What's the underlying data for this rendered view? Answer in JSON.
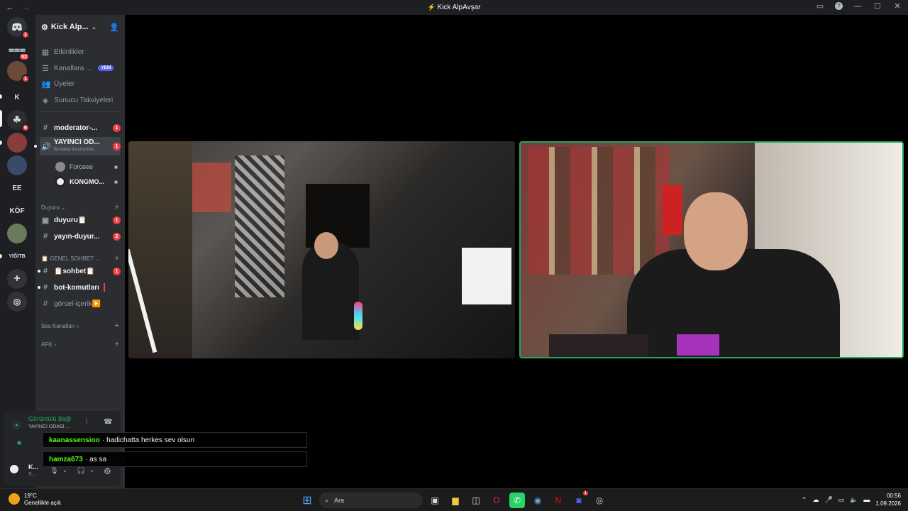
{
  "window": {
    "title": "Kick AlpAvşar",
    "back": "←",
    "forward": "→"
  },
  "guilds": [
    {
      "name": "discord-home",
      "label": "",
      "badge": "1"
    },
    {
      "name": "server-2",
      "label": "",
      "badge": "52"
    },
    {
      "name": "server-3",
      "label": "",
      "badge": "1"
    },
    {
      "name": "server-k",
      "label": "K",
      "badge": ""
    },
    {
      "name": "server-kick",
      "label": "",
      "badge": "6"
    },
    {
      "name": "server-6",
      "label": "",
      "badge": ""
    },
    {
      "name": "server-7",
      "label": "",
      "badge": ""
    },
    {
      "name": "server-ee",
      "label": "EE",
      "badge": ""
    },
    {
      "name": "server-kof",
      "label": "KÖF",
      "badge": ""
    },
    {
      "name": "server-10",
      "label": "",
      "badge": ""
    },
    {
      "name": "server-yigitb",
      "label": "YİĞİTB",
      "badge": ""
    }
  ],
  "server": {
    "name": "Kick Alp...",
    "links": [
      {
        "label": "Etkinlikler"
      },
      {
        "label": "Kanallara ...",
        "tag": "YENİ"
      },
      {
        "label": "Üyeler"
      },
      {
        "label": "Sunucu Takviyeleri"
      }
    ],
    "channels_top": [
      {
        "label": "moderator-...",
        "badge": "1"
      },
      {
        "label": "YAYINCI OD...",
        "sub": "Bir kanal durumu bel...",
        "badge": "1"
      }
    ],
    "voice_users": [
      {
        "name": "Forceee"
      },
      {
        "name": "KONGMO..."
      }
    ],
    "categories": {
      "duyuru": "Duyuru",
      "genel": "📋 GENEL SOHBET ...",
      "ses": "Ses Kanalları",
      "afk": "AFK"
    },
    "duyuru_channels": [
      {
        "label": "duyuru📋",
        "badge": "1"
      },
      {
        "label": "yayın-duyur...",
        "badge": "2"
      }
    ],
    "genel_channels": [
      {
        "label": "📋sohbet📋",
        "badge": "1"
      },
      {
        "label": "bot-komutları",
        "badge": ""
      },
      {
        "label": "görsel-içerik▶️",
        "badge": ""
      }
    ]
  },
  "voice_panel": {
    "status": "Görüntülü Bağl",
    "channel": "YAYINCI ODASI ..."
  },
  "me": {
    "name": "K...",
    "sub": "S..."
  },
  "chat": [
    {
      "user": "kaanassensioo",
      "message": "hadichatta herkes sev olsun"
    },
    {
      "user": "hamza673",
      "message": "as sa"
    }
  ],
  "taskbar": {
    "temp": "19°C",
    "weather": "Genellikle açık",
    "search_placeholder": "Ara",
    "time": "00:56",
    "date": "1.09.2026",
    "discord_badge": "1"
  }
}
